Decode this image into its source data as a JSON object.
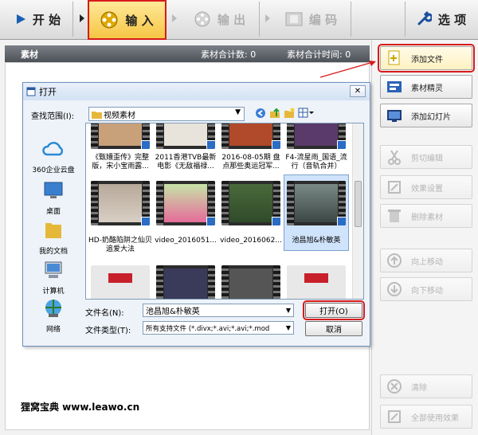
{
  "toolbar": {
    "start": "开 始",
    "import": "输 入",
    "export": "输 出",
    "edit": "编 码",
    "options": "选 项"
  },
  "material_bar": {
    "title": "素材",
    "count_label": "素材合计数: 0",
    "time_label": "素材合计时间: 0"
  },
  "right_panel": {
    "buttons": [
      {
        "label": "添加文件",
        "enabled": true
      },
      {
        "label": "素材精灵",
        "enabled": true
      },
      {
        "label": "添加幻灯片",
        "enabled": true
      },
      {
        "label": "剪切编辑",
        "enabled": false
      },
      {
        "label": "效果设置",
        "enabled": false
      },
      {
        "label": "删除素材",
        "enabled": false
      },
      {
        "label": "向上移动",
        "enabled": false
      },
      {
        "label": "向下移动",
        "enabled": false
      },
      {
        "label": "清除",
        "enabled": false
      },
      {
        "label": "全部使用效果",
        "enabled": false
      }
    ]
  },
  "dialog": {
    "title": "打开",
    "lookin_label": "查找范围(I):",
    "lookin_value": "视频素材",
    "places": [
      "360企业云盘",
      "桌面",
      "我的文档",
      "计算机",
      "网络"
    ],
    "files": [
      {
        "caption": "《甄嬛歪传》完整版，宋小宝雨露...",
        "selected": false
      },
      {
        "caption": "2011香港TVB最新电影《无敌福禄...",
        "selected": false
      },
      {
        "caption": "2016-08-05期 盘点那些奥运冠军...",
        "selected": false
      },
      {
        "caption": "F4-流星雨_国语_流行（音轨合并）",
        "selected": false
      },
      {
        "caption": "HD-奶酪陷阱之仙贝追爱大法",
        "selected": false
      },
      {
        "caption": "video_2016051...",
        "selected": false
      },
      {
        "caption": "video_2016062...",
        "selected": false
      },
      {
        "caption": "池昌旭&朴敏英",
        "selected": true
      }
    ],
    "filename_label": "文件名(N):",
    "filename_value": "池昌旭&朴敏英",
    "filetype_label": "文件类型(T):",
    "filetype_value": "所有支持文件 (*.divx;*.avi;*.avi;*.mod",
    "open_button": "打开(O)",
    "cancel_button": "取消"
  },
  "watermark": "狸窝宝典  www.leawo.cn",
  "colors": {
    "highlight": "#d81b1b",
    "active_tab": "#f5c542",
    "material_bar": "#5a5f66"
  }
}
